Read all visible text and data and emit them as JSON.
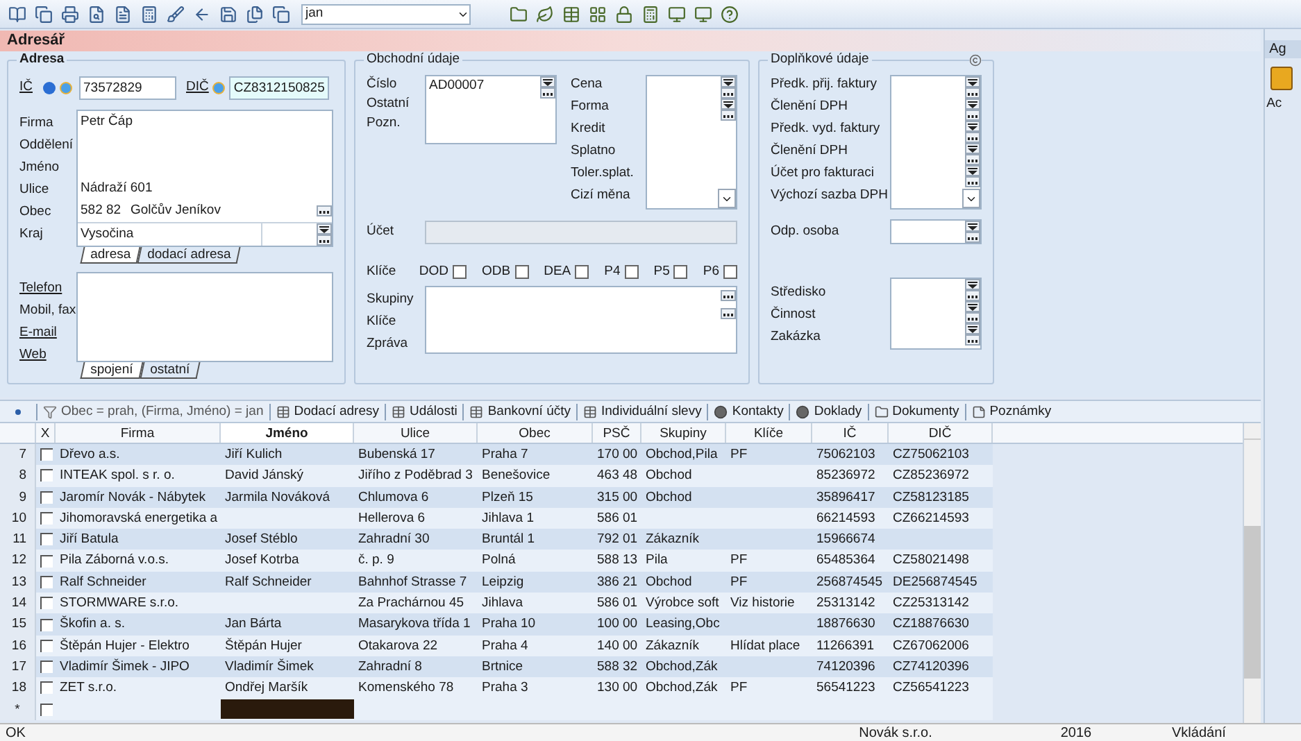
{
  "toolbar": {
    "search_value": "jan"
  },
  "window_title": "Adresář",
  "adresa": {
    "title": "Adresa",
    "ic_label": "IČ",
    "ic_value": "73572829",
    "dic_label": "DIČ",
    "dic_value": "CZ8312150825",
    "fields": [
      {
        "label": "Firma",
        "kind": "text",
        "value": "Petr Čáp"
      },
      {
        "label": "Oddělení",
        "kind": "text"
      },
      {
        "label": "Jméno",
        "kind": "text"
      },
      {
        "label": "Ulice",
        "kind": "text",
        "value": "Nádraží 601"
      },
      {
        "label": "Obec",
        "kind": "city",
        "zip": "582 82",
        "value": "Golčův Jeníkov"
      },
      {
        "label": "Kraj",
        "kind": "combo",
        "value": "Vysočina"
      }
    ],
    "address_tabs": [
      {
        "label": "adresa",
        "selected": true
      },
      {
        "label": "dodací adresa",
        "selected": false
      }
    ],
    "contacts": [
      {
        "label": "Telefon",
        "link": true
      },
      {
        "label": "Mobil, fax",
        "link": false
      },
      {
        "label": "E-mail",
        "link": true
      },
      {
        "label": "Web",
        "link": true
      }
    ],
    "contact_tabs": [
      {
        "label": "spojení",
        "selected": true
      },
      {
        "label": "ostatní",
        "selected": false
      }
    ]
  },
  "obchodni": {
    "title": "Obchodní údaje",
    "number_labels": [
      "Číslo",
      "Ostatní",
      "Pozn."
    ],
    "number_value": "AD00007",
    "terms_labels": [
      "Cena",
      "Forma",
      "Kredit",
      "Splatno",
      "Toler.splat.",
      "Cizí měna"
    ],
    "account": {
      "label": "Účet",
      "disabled": true
    },
    "keys_label": "Klíče",
    "flags": [
      {
        "label": "DOD",
        "checked": false
      },
      {
        "label": "ODB",
        "checked": false
      },
      {
        "label": "DEA",
        "checked": false
      },
      {
        "label": "P4",
        "checked": false
      },
      {
        "label": "P5",
        "checked": false
      },
      {
        "label": "P6",
        "checked": false
      }
    ],
    "notes_labels": [
      "Skupiny",
      "Klíče",
      "Zpráva"
    ]
  },
  "doplnkove": {
    "title": "Doplňkové údaje",
    "invoice_labels": [
      "Předk. přij. faktury",
      "Členění DPH",
      "Předk. vyd. faktury",
      "Členění DPH",
      "Účet pro fakturaci",
      "Výchozí sazba DPH"
    ],
    "person_label": "Odp. osoba",
    "centre_labels": [
      "Středisko",
      "Činnost",
      "Zakázka"
    ]
  },
  "detail_tabs": [
    {
      "label": "Obec = prah, (Firma, Jméno) = jan",
      "kind": "filter"
    },
    {
      "label": "Dodací adresy",
      "kind": "table"
    },
    {
      "label": "Události",
      "kind": "table"
    },
    {
      "label": "Bankovní účty",
      "kind": "table"
    },
    {
      "label": "Individuální slevy",
      "kind": "table"
    },
    {
      "label": "Kontakty",
      "kind": "circle"
    },
    {
      "label": "Doklady",
      "kind": "circle"
    },
    {
      "label": "Dokumenty",
      "kind": "folder"
    },
    {
      "label": "Poznámky",
      "kind": "note"
    }
  ],
  "table": {
    "check_column_label": "X",
    "columns": [
      {
        "label": "Firma",
        "selected": false
      },
      {
        "label": "Jméno",
        "selected": true
      },
      {
        "label": "Ulice",
        "selected": false
      },
      {
        "label": "Obec",
        "selected": false
      },
      {
        "label": "PSČ",
        "selected": false
      },
      {
        "label": "Skupiny",
        "selected": false
      },
      {
        "label": "Klíče",
        "selected": false
      },
      {
        "label": "IČ",
        "selected": false
      },
      {
        "label": "DIČ",
        "selected": false
      }
    ],
    "rows": [
      {
        "number": "7",
        "checked": false,
        "cells": [
          "Dřevo a.s.",
          "Jiří Kulich",
          "Bubenská 17",
          "Praha 7",
          "170 00",
          "Obchod,Pila",
          "PF",
          "75062103",
          "CZ75062103"
        ]
      },
      {
        "number": "8",
        "checked": false,
        "cells": [
          "INTEAK spol. s r. o.",
          "David Jánský",
          "Jiřího z Poděbrad 3",
          "Benešovice",
          "463 48",
          "Obchod",
          null,
          "85236972",
          "CZ85236972"
        ]
      },
      {
        "number": "9",
        "checked": false,
        "cells": [
          "Jaromír Novák - Nábytek",
          "Jarmila Nováková",
          "Chlumova 6",
          "Plzeň 15",
          "315 00",
          "Obchod",
          null,
          "35896417",
          "CZ58123185"
        ]
      },
      {
        "number": "10",
        "checked": false,
        "cells": [
          "Jihomoravská energetika a",
          null,
          "Hellerova 6",
          "Jihlava 1",
          "586 01",
          null,
          null,
          "66214593",
          "CZ66214593"
        ]
      },
      {
        "number": "11",
        "checked": false,
        "cells": [
          "Jiří Batula",
          "Josef Stéblo",
          "Zahradní 30",
          "Bruntál 1",
          "792 01",
          "Zákazník",
          null,
          "15966674",
          null
        ]
      },
      {
        "number": "12",
        "checked": false,
        "cells": [
          "Pila Záborná v.o.s.",
          "Josef Kotrba",
          "č. p. 9",
          "Polná",
          "588 13",
          "Pila",
          "PF",
          "65485364",
          "CZ58021498"
        ]
      },
      {
        "number": "13",
        "checked": false,
        "cells": [
          "Ralf Schneider",
          "Ralf Schneider",
          "Bahnhof Strasse 7",
          "Leipzig",
          "386 21",
          "Obchod",
          "PF",
          "256874545",
          "DE256874545"
        ]
      },
      {
        "number": "14",
        "checked": false,
        "cells": [
          "STORMWARE s.r.o.",
          null,
          "Za Prachárnou 45",
          "Jihlava",
          "586 01",
          "Výrobce soft",
          "Viz historie",
          "25313142",
          "CZ25313142"
        ]
      },
      {
        "number": "15",
        "checked": false,
        "cells": [
          "Škofin a. s.",
          "Jan Bárta",
          "Masarykova třída 1",
          "Praha 10",
          "100 00",
          "Leasing,Obc",
          null,
          "18876630",
          "CZ18876630"
        ]
      },
      {
        "number": "16",
        "checked": false,
        "cells": [
          "Štěpán Hujer - Elektro",
          "Štěpán Hujer",
          "Otakarova 22",
          "Praha 4",
          "140 00",
          "Zákazník",
          "Hlídat place",
          "11266391",
          "CZ67062006"
        ]
      },
      {
        "number": "17",
        "checked": false,
        "cells": [
          "Vladimír Šimek - JIPO",
          "Vladimír Šimek",
          "Zahradní 8",
          "Brtnice",
          "588 32",
          "Obchod,Zák",
          null,
          "74120396",
          "CZ74120396"
        ]
      },
      {
        "number": "18",
        "checked": false,
        "cells": [
          "ZET s.r.o.",
          "Ondřej Maršík",
          "Komenského 78",
          "Praha 3",
          "130 00",
          "Obchod,Zák",
          "PF",
          "56541223",
          "CZ56541223"
        ]
      }
    ],
    "new_row": {
      "marker": "*",
      "checked": false
    }
  },
  "status_bar": [
    "OK",
    "Novák s.r.o.",
    "2016",
    "Vkládání"
  ],
  "side_panel": {
    "title": "Ag",
    "label": "Ac"
  }
}
